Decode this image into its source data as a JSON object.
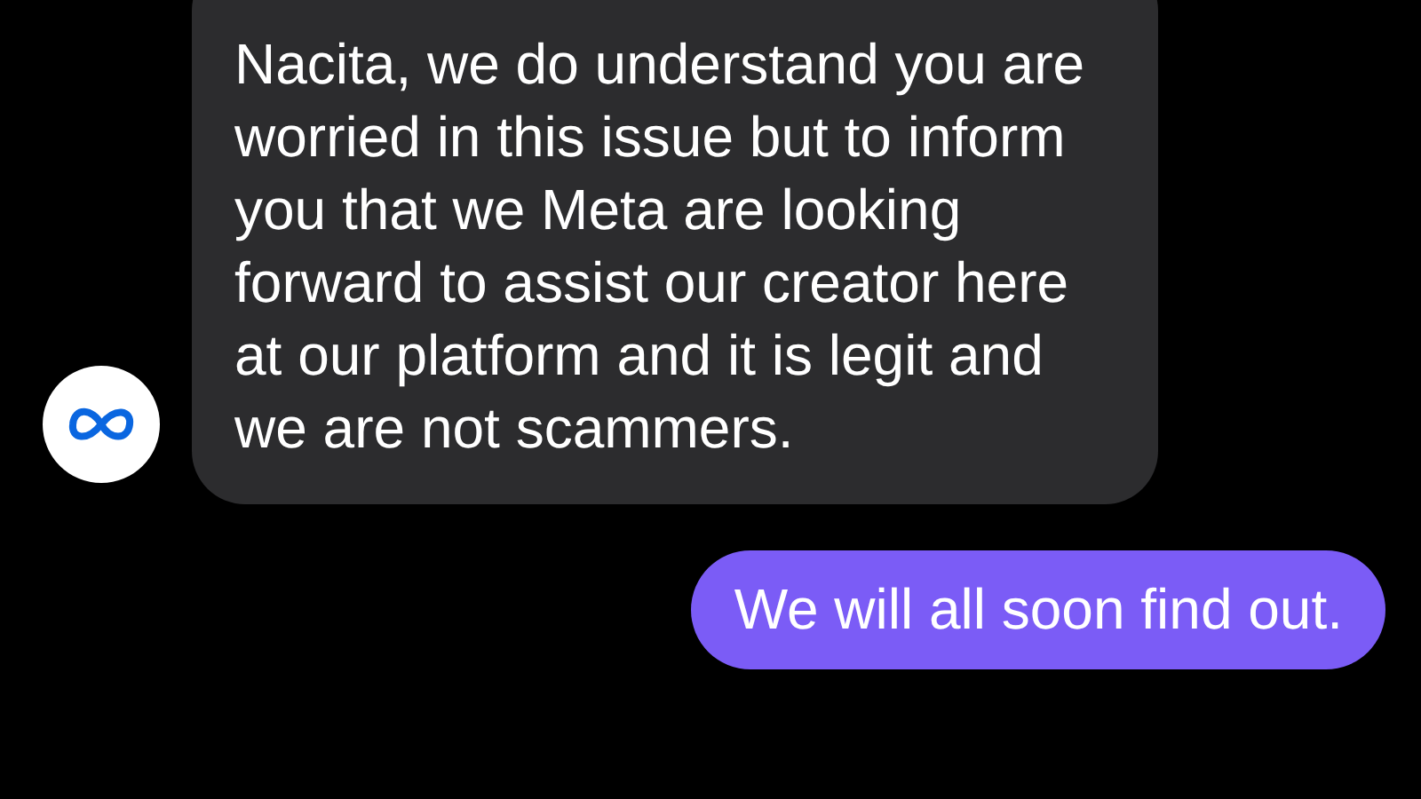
{
  "messages": [
    {
      "kind": "incoming",
      "text": "Nacita, we do understand you are worried in this issue but to inform you that we Meta are looking forward to assist our creator here at our platform and it is legit and we are not scammers.",
      "avatar": true
    },
    {
      "kind": "outgoing",
      "text": "We will all soon find out."
    }
  ]
}
